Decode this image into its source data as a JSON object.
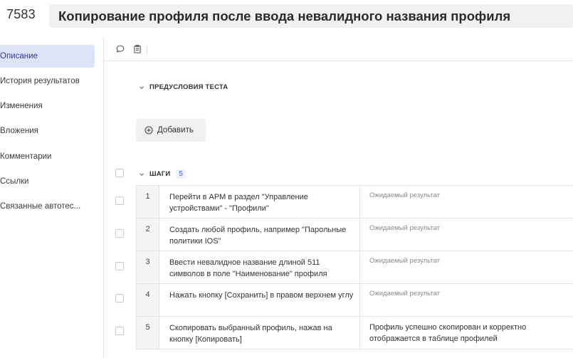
{
  "header": {
    "case_id": "7583",
    "title": "Копирование профиля после ввода невалидного названия профиля"
  },
  "sidebar": {
    "items": [
      {
        "label": "Описание",
        "active": true
      },
      {
        "label": "История результатов",
        "active": false
      },
      {
        "label": "Изменения",
        "active": false
      },
      {
        "label": "Вложения",
        "active": false
      },
      {
        "label": "Комментарии",
        "active": false
      },
      {
        "label": "Ссылки",
        "active": false
      },
      {
        "label": "Связанные автотес...",
        "active": false
      }
    ]
  },
  "toolbar": {
    "icons": [
      "comment-icon",
      "clipboard-icon"
    ]
  },
  "preconditions": {
    "title": "ПРЕДУСЛОВИЯ ТЕСТА",
    "add_label": "Добавить"
  },
  "steps": {
    "title": "ШАГИ",
    "count": "5",
    "expected_placeholder": "Ожидаемый результат",
    "rows": [
      {
        "num": "1",
        "action": "Перейти в АРМ в раздел \"Управление устройствами\" - \"Профили\"",
        "expected": ""
      },
      {
        "num": "2",
        "action": "Создать любой профиль, например \"Парольные политики IOS\"",
        "expected": ""
      },
      {
        "num": "3",
        "action": "Ввести невалидное название длиной 511 символов в поле \"Наименование\" профиля",
        "expected": ""
      },
      {
        "num": "4",
        "action": "Нажать кнопку [Сохранить] в правом верхнем углу",
        "expected": ""
      },
      {
        "num": "5",
        "action": "Скопировать выбранный профиль, нажав на кнопку [Копировать]",
        "expected": "Профиль успешно скопирован и корректно отображается в таблице профилей"
      }
    ]
  },
  "colors": {
    "active_nav_bg": "#dfe3f7",
    "title_bg": "#f1f1f3",
    "badge_text": "#4a5bd0"
  }
}
